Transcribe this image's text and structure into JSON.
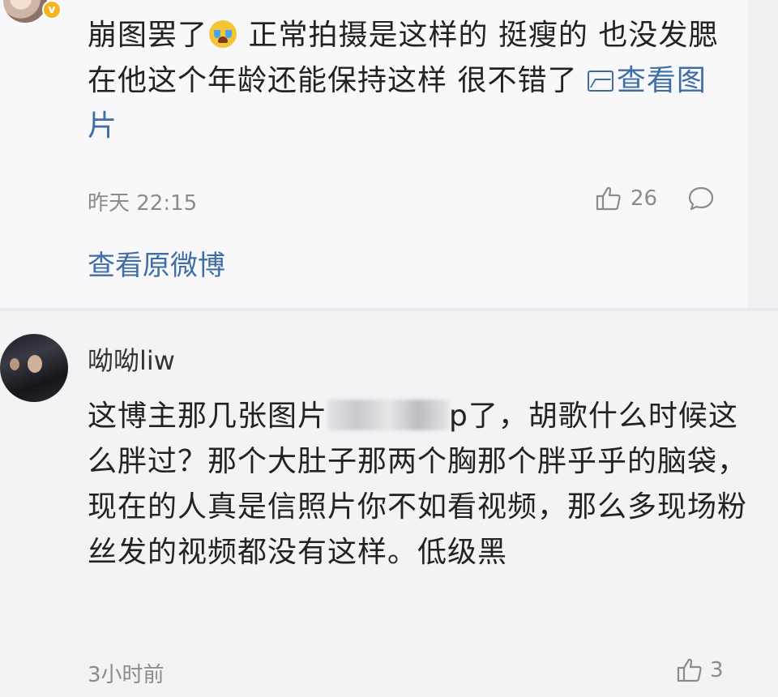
{
  "comment1": {
    "text_part1": "崩图罢了",
    "text_part2": " 正常拍摄是这样的 挺瘦的 也没发腮 在他这个年龄还能保持这样 很不错了",
    "view_image_label": "查看图片",
    "time": "昨天 22:15",
    "likes": "26",
    "view_original_label": "查看原微博",
    "verified_badge": "v"
  },
  "comment2": {
    "username": "呦呦liw",
    "text_part1": "这博主那几张图片",
    "text_part2": "p了，胡歌什么时候这么胖过？那个大肚子那两个胸那个胖乎乎的脑袋，现在的人真是信照片你不如看视频，那么多现场粉丝发的视频都没有这样。低级黑",
    "time": "3小时前",
    "likes": "3"
  },
  "icons": {
    "like": "thumbs-up-icon",
    "comment": "comment-bubble-icon",
    "image": "image-icon",
    "emoji": "crying-face-emoji",
    "verified": "verified-badge-icon"
  },
  "colors": {
    "link": "#3f6ea6",
    "meta": "#8b8b8b",
    "badge": "#f5b522"
  }
}
